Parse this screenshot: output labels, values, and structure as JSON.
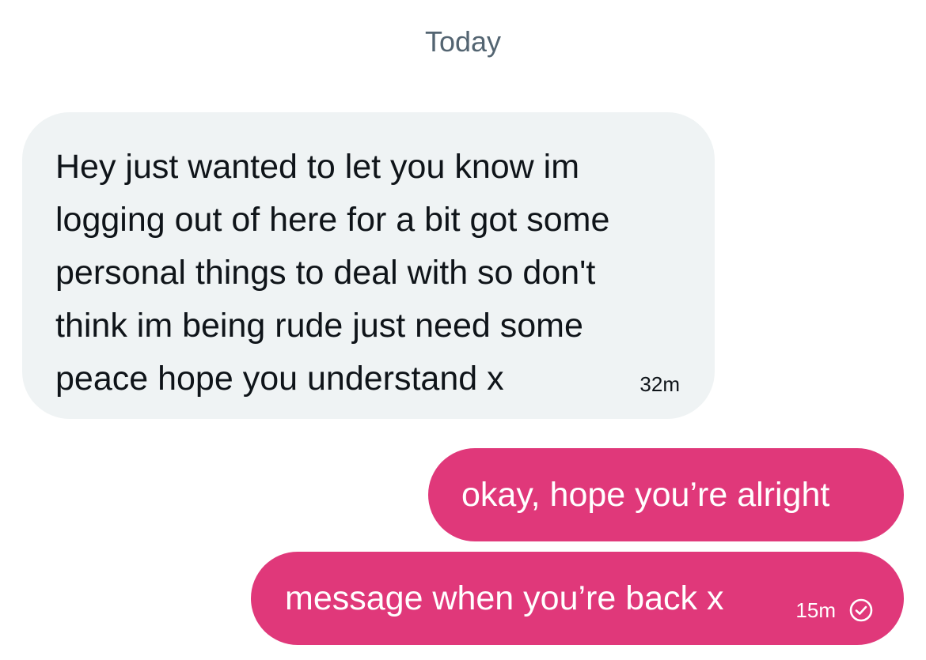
{
  "date_divider": "Today",
  "messages": [
    {
      "direction": "incoming",
      "text": "Hey just wanted to let you know im\nlogging out of here for a bit got some\npersonal things to deal with so don't\nthink im being rude just need some\npeace hope you understand x",
      "time": "32m"
    },
    {
      "direction": "outgoing",
      "text": "okay, hope you’re alright"
    },
    {
      "direction": "outgoing",
      "text": "message when you’re back x",
      "time": "15m",
      "status_icon": "read-check-icon"
    }
  ],
  "colors": {
    "incoming_bubble": "#eff3f4",
    "outgoing_bubble": "#e0387a",
    "divider_text": "#536471"
  }
}
